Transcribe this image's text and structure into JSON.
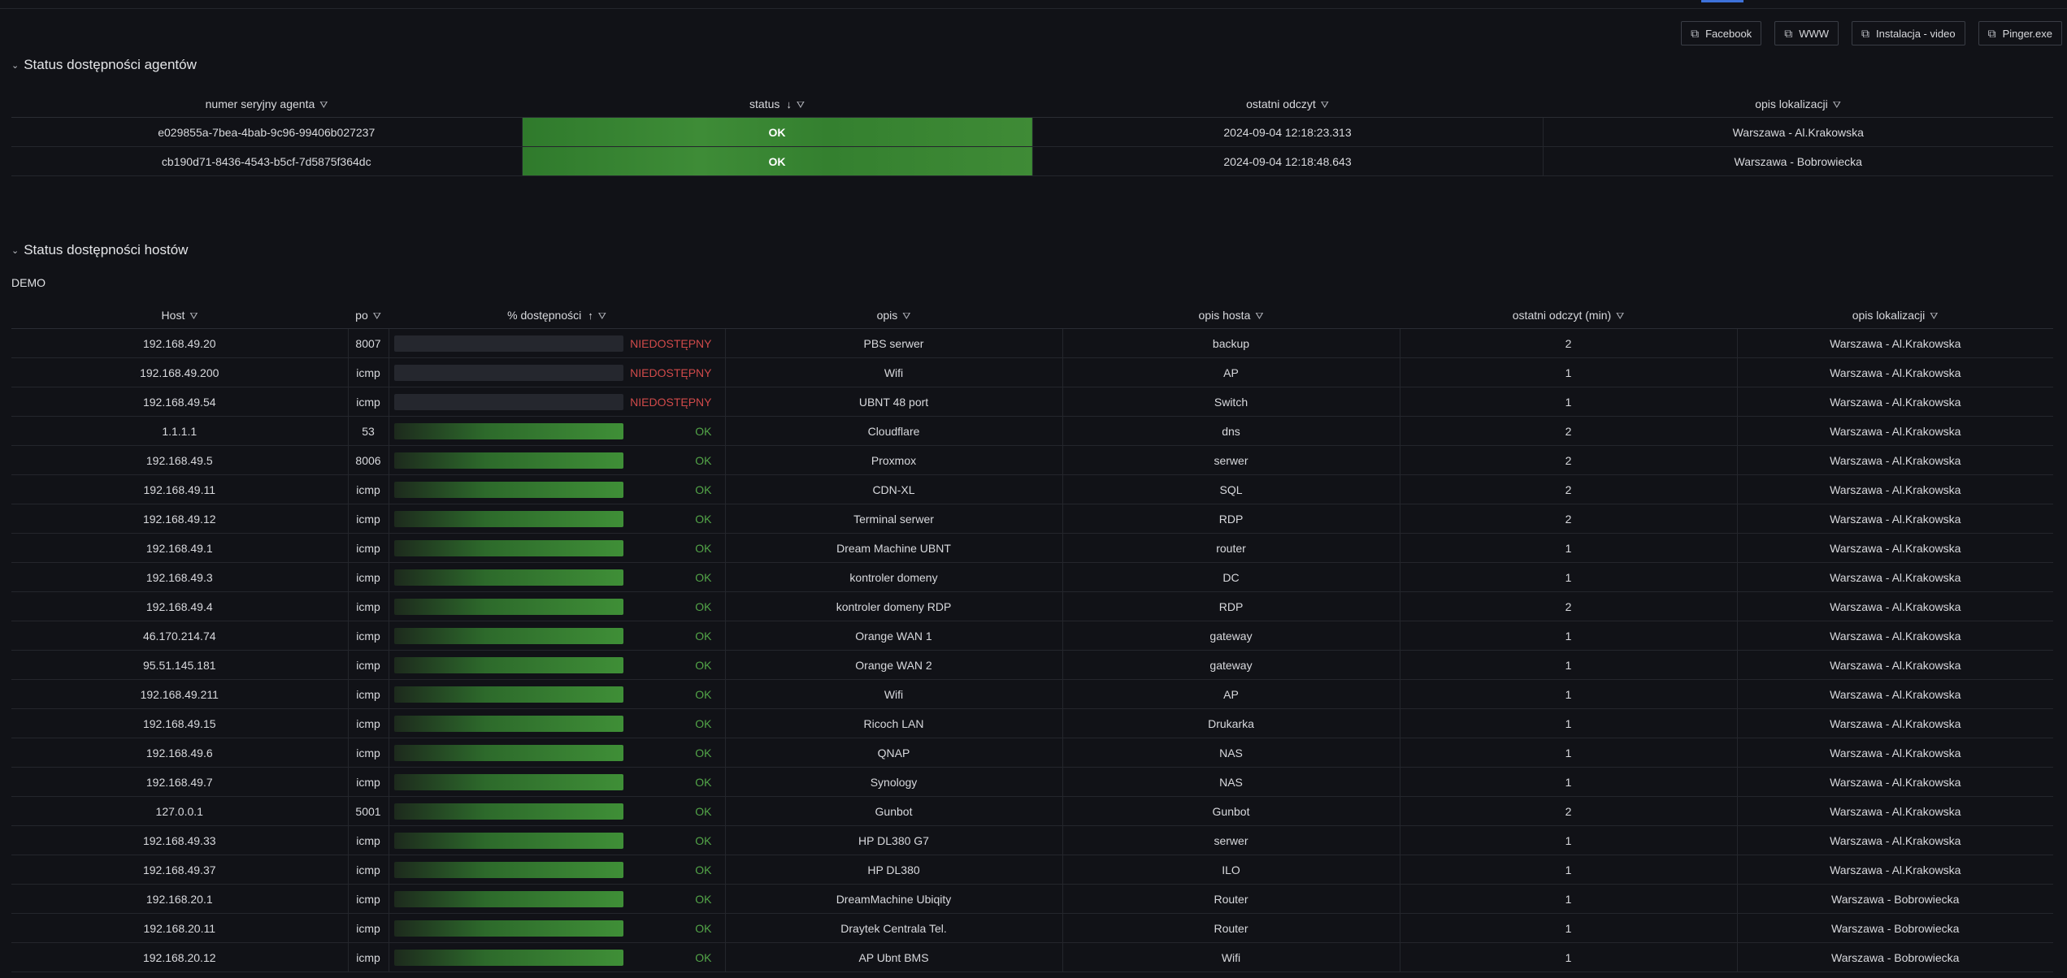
{
  "links": [
    {
      "icon": "external-link-icon",
      "label": "Facebook"
    },
    {
      "icon": "external-link-icon",
      "label": "WWW"
    },
    {
      "icon": "external-link-icon",
      "label": "Instalacja - video"
    },
    {
      "icon": "external-link-icon",
      "label": "Pinger.exe"
    }
  ],
  "agents_section": {
    "title": "Status dostępności agentów",
    "columns": [
      "numer seryjny agenta",
      "status",
      "ostatni odczyt",
      "opis lokalizacji"
    ],
    "rows": [
      [
        "e029855a-7bea-4bab-9c96-99406b027237",
        "OK",
        "2024-09-04 12:18:23.313",
        "Warszawa - Al.Krakowska"
      ],
      [
        "cb190d71-8436-4543-b5cf-7d5875f364dc",
        "OK",
        "2024-09-04 12:18:48.643",
        "Warszawa - Bobrowiecka"
      ]
    ]
  },
  "hosts_section": {
    "title": "Status dostępności hostów",
    "group_label": "DEMO",
    "columns": [
      "Host",
      "po",
      "% dostępności",
      "opis",
      "opis hosta",
      "ostatni odczyt (min)",
      "opis lokalizacji"
    ],
    "rows": [
      [
        "192.168.49.20",
        "8007",
        "NIEDOSTĘPNY",
        "PBS serwer",
        "backup",
        "2",
        "Warszawa - Al.Krakowska"
      ],
      [
        "192.168.49.200",
        "icmp",
        "NIEDOSTĘPNY",
        "Wifi",
        "AP",
        "1",
        "Warszawa - Al.Krakowska"
      ],
      [
        "192.168.49.54",
        "icmp",
        "NIEDOSTĘPNY",
        "UBNT 48 port",
        "Switch",
        "1",
        "Warszawa - Al.Krakowska"
      ],
      [
        "1.1.1.1",
        "53",
        "OK",
        "Cloudflare",
        "dns",
        "2",
        "Warszawa - Al.Krakowska"
      ],
      [
        "192.168.49.5",
        "8006",
        "OK",
        "Proxmox",
        "serwer",
        "2",
        "Warszawa - Al.Krakowska"
      ],
      [
        "192.168.49.11",
        "icmp",
        "OK",
        "CDN-XL",
        "SQL",
        "2",
        "Warszawa - Al.Krakowska"
      ],
      [
        "192.168.49.12",
        "icmp",
        "OK",
        "Terminal serwer",
        "RDP",
        "2",
        "Warszawa - Al.Krakowska"
      ],
      [
        "192.168.49.1",
        "icmp",
        "OK",
        "Dream Machine UBNT",
        "router",
        "1",
        "Warszawa - Al.Krakowska"
      ],
      [
        "192.168.49.3",
        "icmp",
        "OK",
        "kontroler domeny",
        "DC",
        "1",
        "Warszawa - Al.Krakowska"
      ],
      [
        "192.168.49.4",
        "icmp",
        "OK",
        "kontroler domeny RDP",
        "RDP",
        "2",
        "Warszawa - Al.Krakowska"
      ],
      [
        "46.170.214.74",
        "icmp",
        "OK",
        "Orange WAN 1",
        "gateway",
        "1",
        "Warszawa - Al.Krakowska"
      ],
      [
        "95.51.145.181",
        "icmp",
        "OK",
        "Orange WAN 2",
        "gateway",
        "1",
        "Warszawa - Al.Krakowska"
      ],
      [
        "192.168.49.211",
        "icmp",
        "OK",
        "Wifi",
        "AP",
        "1",
        "Warszawa - Al.Krakowska"
      ],
      [
        "192.168.49.15",
        "icmp",
        "OK",
        "Ricoch LAN",
        "Drukarka",
        "1",
        "Warszawa - Al.Krakowska"
      ],
      [
        "192.168.49.6",
        "icmp",
        "OK",
        "QNAP",
        "NAS",
        "1",
        "Warszawa - Al.Krakowska"
      ],
      [
        "192.168.49.7",
        "icmp",
        "OK",
        "Synology",
        "NAS",
        "1",
        "Warszawa - Al.Krakowska"
      ],
      [
        "127.0.0.1",
        "5001",
        "OK",
        "Gunbot",
        "Gunbot",
        "2",
        "Warszawa - Al.Krakowska"
      ],
      [
        "192.168.49.33",
        "icmp",
        "OK",
        "HP DL380 G7",
        "serwer",
        "1",
        "Warszawa - Al.Krakowska"
      ],
      [
        "192.168.49.37",
        "icmp",
        "OK",
        "HP DL380",
        "ILO",
        "1",
        "Warszawa - Al.Krakowska"
      ],
      [
        "192.168.20.1",
        "icmp",
        "OK",
        "DreamMachine Ubiqity",
        "Router",
        "1",
        "Warszawa - Bobrowiecka"
      ],
      [
        "192.168.20.11",
        "icmp",
        "OK",
        "Draytek Centrala Tel.",
        "Router",
        "1",
        "Warszawa - Bobrowiecka"
      ],
      [
        "192.168.20.12",
        "icmp",
        "OK",
        "AP Ubnt BMS",
        "Wifi",
        "1",
        "Warszawa - Bobrowiecka"
      ]
    ]
  }
}
